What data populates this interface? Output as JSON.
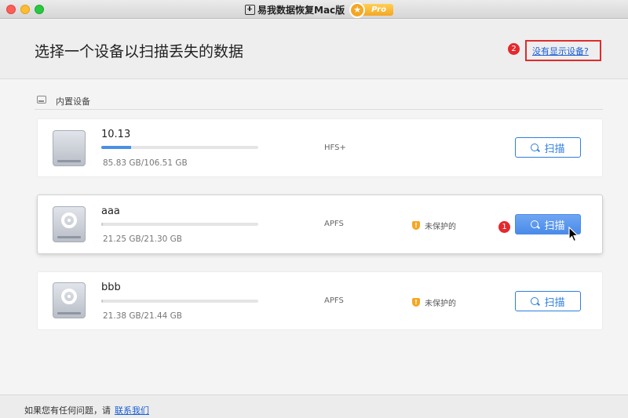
{
  "window": {
    "title": "易我数据恢复Mac版",
    "pro_label": "Pro"
  },
  "header": {
    "title": "选择一个设备以扫描丢失的数据",
    "help_link": "没有显示设备?",
    "help_badge": "2"
  },
  "section": {
    "label": "内置设备"
  },
  "devices": [
    {
      "name": "10.13",
      "usage_fraction": 0.19,
      "size": "85.83 GB/106.51 GB",
      "fs": "HFS+",
      "protection": "",
      "scan_label": "扫描",
      "icon": "apple-drive-icon"
    },
    {
      "name": "aaa",
      "usage_fraction": 0.01,
      "size": "21.25 GB/21.30 GB",
      "fs": "APFS",
      "protection": "未保护的",
      "scan_label": "扫描",
      "icon": "disk-drive-icon",
      "badge": "1"
    },
    {
      "name": "bbb",
      "usage_fraction": 0.01,
      "size": "21.38 GB/21.44 GB",
      "fs": "APFS",
      "protection": "未保护的",
      "scan_label": "扫描",
      "icon": "disk-drive-icon"
    }
  ],
  "footer": {
    "text": "如果您有任何问题，请",
    "link": "联系我们"
  },
  "colors": {
    "accent": "#2f7fde",
    "annotation_red": "#e02b2b",
    "warning": "#f5a623"
  }
}
